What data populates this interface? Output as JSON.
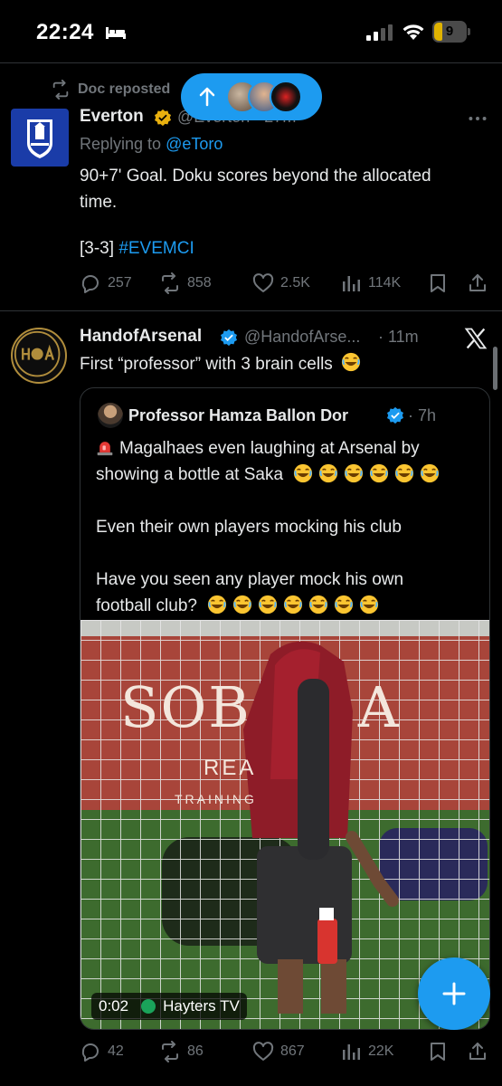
{
  "status_bar": {
    "time": "22:24",
    "battery": "9"
  },
  "colors": {
    "accent": "#1d9bf0",
    "background": "#000000",
    "secondary_text": "#71767b",
    "divider": "#2f3336",
    "everton_blue": "#1a3ca8"
  },
  "icons": [
    "bed-icon",
    "signal-icon",
    "wifi-icon",
    "battery-icon",
    "repost-icon",
    "arrow-up-icon",
    "more-icon",
    "x-logo-icon",
    "reply-icon",
    "like-icon",
    "views-icon",
    "bookmark-icon",
    "share-icon",
    "plus-icon",
    "verified-icon",
    "siren-emoji",
    "laughing-emoji"
  ],
  "repost_header": {
    "text": "Doc reposted"
  },
  "tweet1": {
    "name": "Everton",
    "handle": "@Everton · 27m",
    "replying_label": "Replying to ",
    "replying_to": "@eToro",
    "text_line1": "90+7' Goal. Doku scores beyond the allocated",
    "text_line2": "time.",
    "text_prefix": "[3-3] ",
    "hashtag": "#EVEMCI",
    "stats": {
      "replies": "257",
      "reposts": "858",
      "likes": "2.5K",
      "views": "114K"
    }
  },
  "tweet2": {
    "name": "HandofArsenal",
    "handle": "@HandofArse...",
    "time": "· 11m",
    "text": "First “professor” with 3 brain cells",
    "quote": {
      "name": "Professor Hamza Ballon Dor",
      "time": "· 7h",
      "line1": "Magalhaes even laughing at Arsenal by",
      "line2": "showing a bottle at Saka",
      "line3": "Even their own players mocking his club",
      "line4": "Have you seen any player mock his own",
      "line5": "football club?",
      "video": {
        "duration": "0:02",
        "source": "Hayters TV",
        "board_text": "SOB",
        "board_text2": "A",
        "board_sub": "REA",
        "board_sub2": "TRAINING"
      }
    },
    "stats": {
      "replies": "42",
      "reposts": "86",
      "likes": "867",
      "views": "22K"
    }
  }
}
